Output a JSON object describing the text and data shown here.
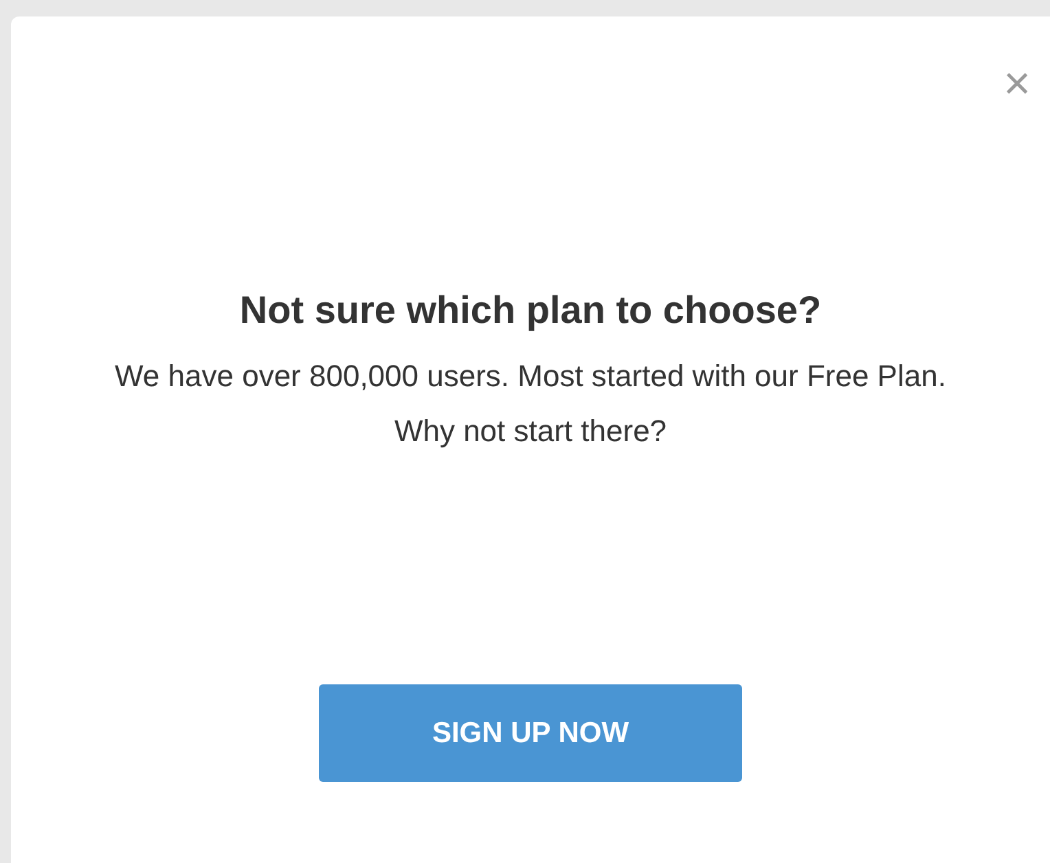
{
  "dialog": {
    "close": "×",
    "title": "Not sure which plan to choose?",
    "message": "We have over 800,000 users. Most started with our Free Plan. Why not start there?",
    "button": "SIGN UP NOW"
  }
}
